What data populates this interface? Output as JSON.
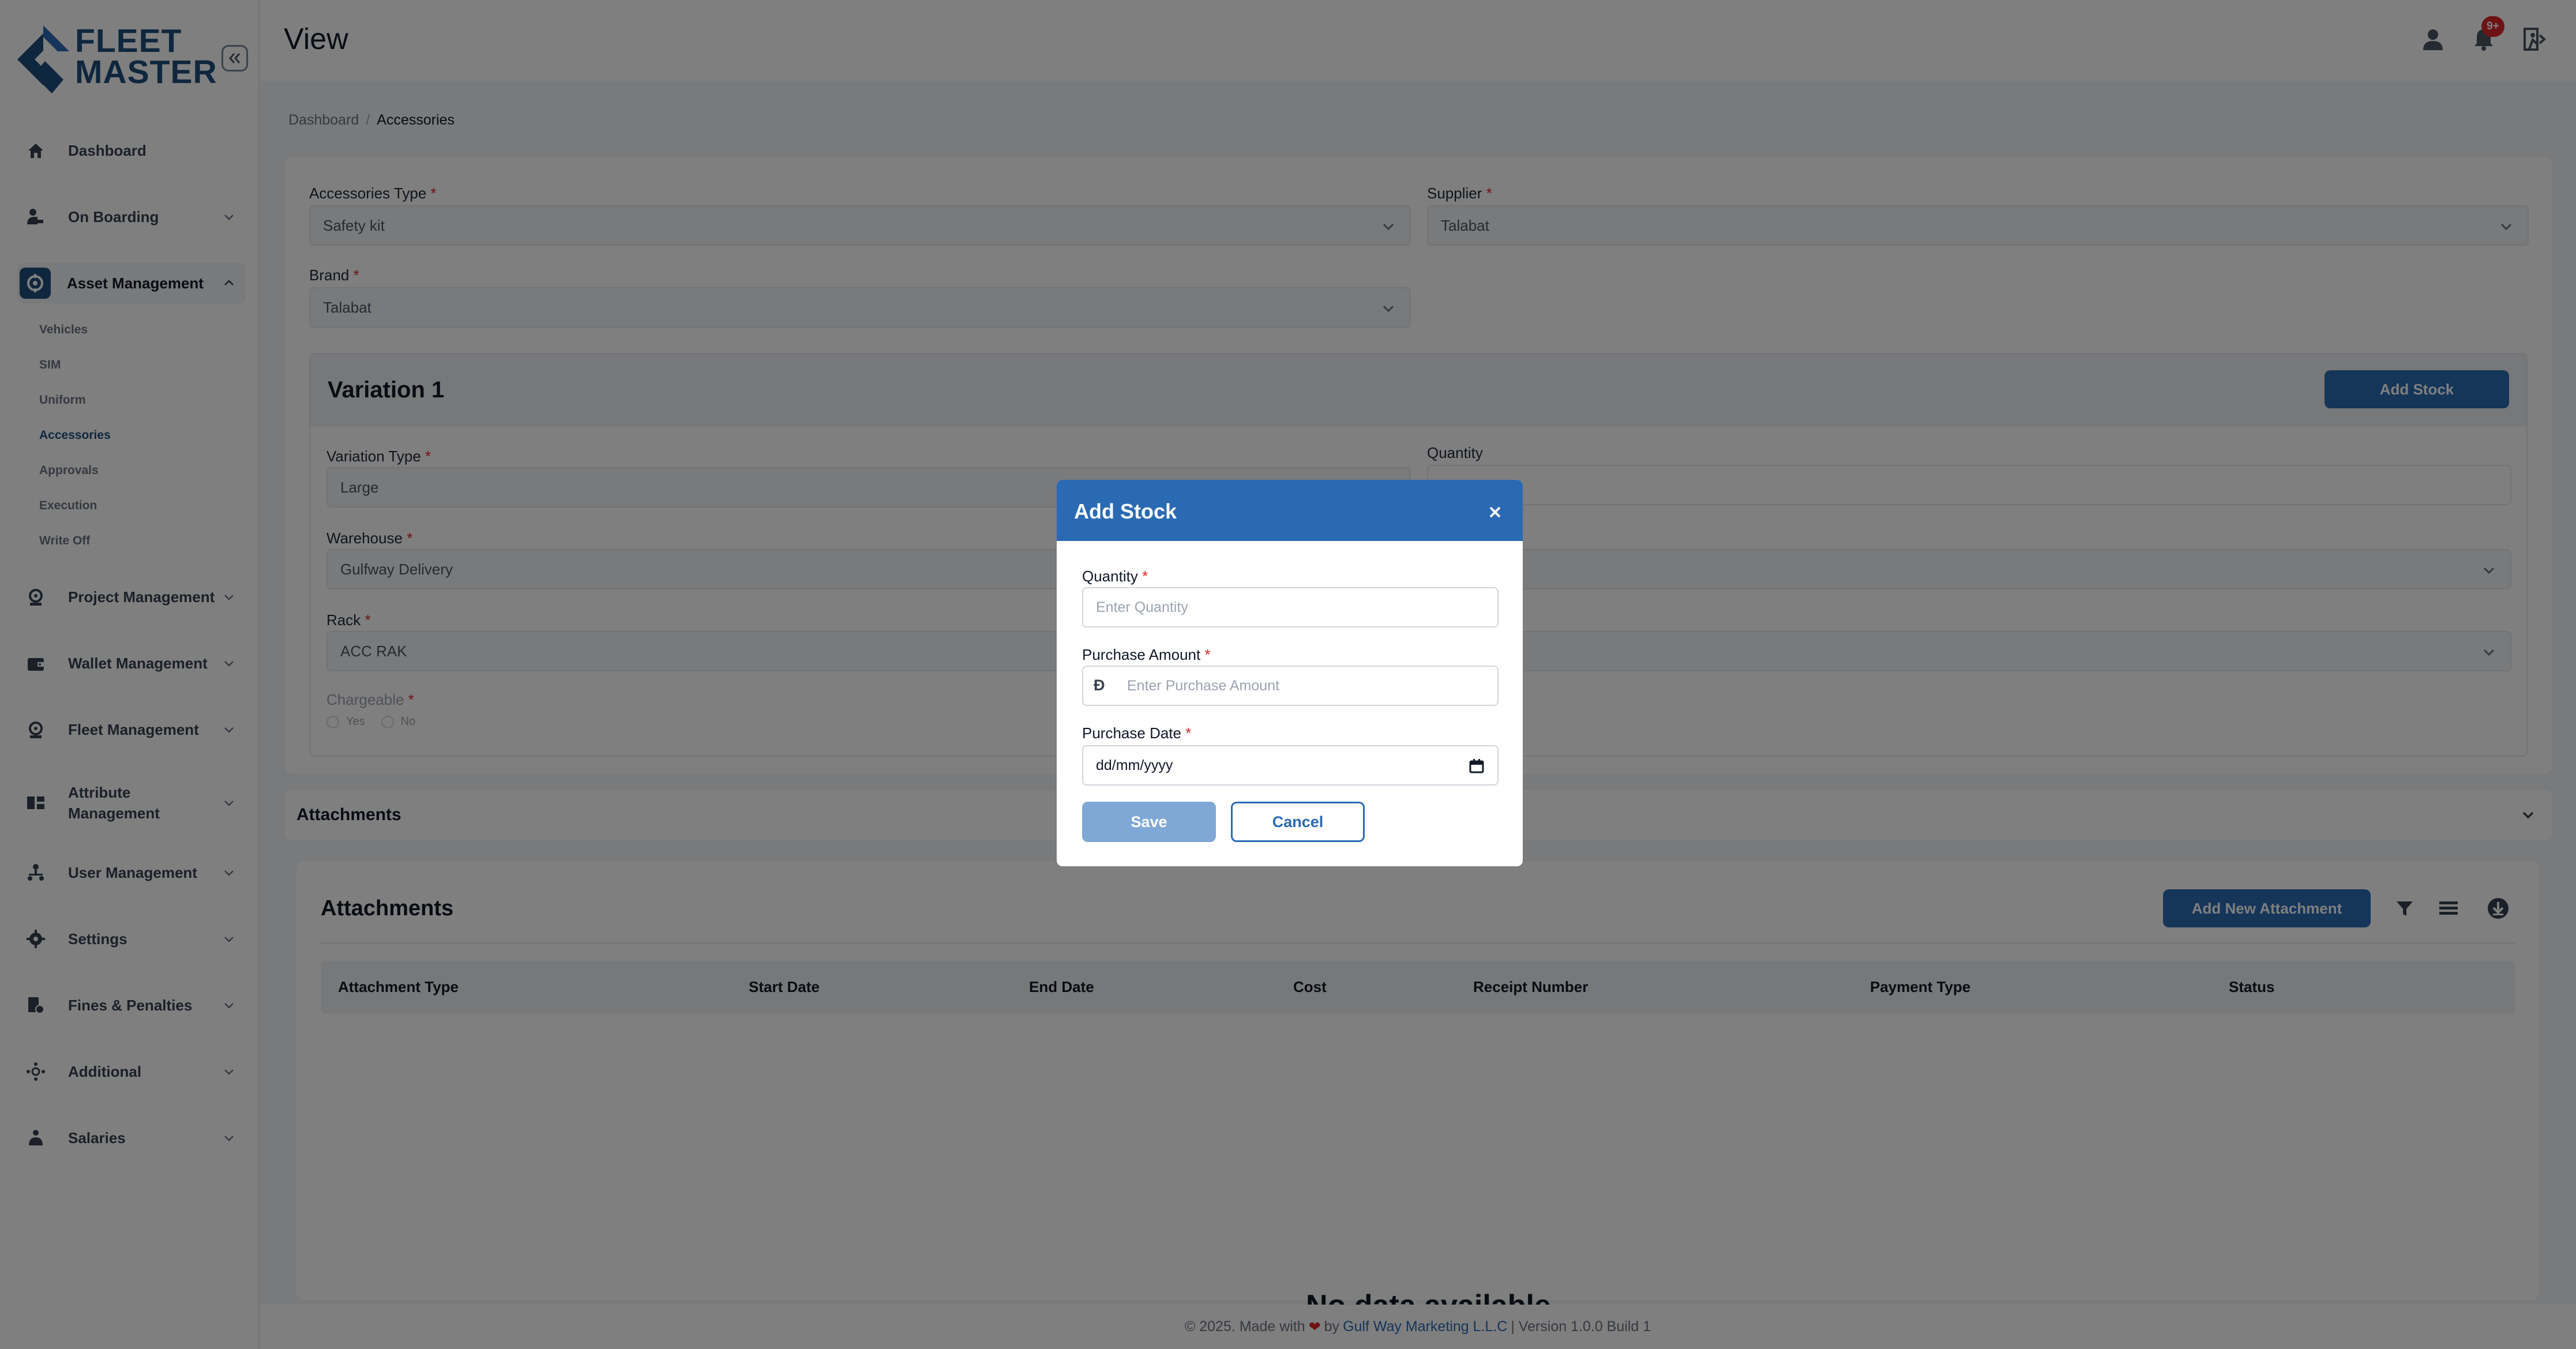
{
  "brand": {
    "line1": "FLEET",
    "line2": "MASTER"
  },
  "header": {
    "title": "View",
    "notification_count": "9+"
  },
  "sidebar": {
    "items": [
      {
        "label": "Dashboard",
        "icon": "home-icon"
      },
      {
        "label": "On Boarding",
        "icon": "onboarding-icon"
      },
      {
        "label": "Asset Management",
        "icon": "asset-icon"
      },
      {
        "label": "Project Management",
        "icon": "project-icon"
      },
      {
        "label": "Wallet Management",
        "icon": "wallet-icon"
      },
      {
        "label": "Fleet Management",
        "icon": "fleet-icon"
      },
      {
        "label": "Attribute Management",
        "icon": "attribute-icon"
      },
      {
        "label": "User Management",
        "icon": "users-icon"
      },
      {
        "label": "Settings",
        "icon": "gear-icon"
      },
      {
        "label": "Fines & Penalties",
        "icon": "fines-icon"
      },
      {
        "label": "Additional",
        "icon": "additional-icon"
      },
      {
        "label": "Salaries",
        "icon": "salaries-icon"
      }
    ],
    "asset_sub_items": [
      "Vehicles",
      "SIM",
      "Uniform",
      "Accessories",
      "Approvals",
      "Execution",
      "Write Off"
    ]
  },
  "breadcrumb": {
    "root": "Dashboard",
    "separator": "/",
    "current": "Accessories"
  },
  "form": {
    "accessories_type_label": "Accessories Type",
    "accessories_type_value": "Safety kit",
    "supplier_label": "Supplier",
    "supplier_value": "Talabat",
    "brand_label": "Brand",
    "brand_value": "Talabat",
    "required_mark": "*"
  },
  "variation": {
    "title": "Variation 1",
    "add_stock_label": "Add Stock",
    "variation_type_label": "Variation Type",
    "variation_type_value": "Large",
    "quantity_label": "Quantity",
    "warehouse_label": "Warehouse",
    "warehouse_value": "Gulfway Delivery",
    "rack_label": "Rack",
    "rack_value": "ACC RAK",
    "chargeable_label": "Chargeable",
    "chargeable_yes": "Yes",
    "chargeable_no": "No"
  },
  "attachments_section": {
    "title": "Attachments"
  },
  "attachments_card": {
    "title": "Attachments",
    "add_button": "Add New Attachment",
    "columns": [
      "Attachment Type",
      "Start Date",
      "End Date",
      "Cost",
      "Receipt Number",
      "Payment Type",
      "Status"
    ],
    "empty_text": "No data available"
  },
  "footer": {
    "prefix": "© 2025. Made with",
    "by": "by",
    "company": "Gulf Way Marketing L.L.C",
    "suffix": "| Version 1.0.0 Build 1"
  },
  "modal": {
    "title": "Add Stock",
    "quantity_label": "Quantity",
    "quantity_placeholder": "Enter Quantity",
    "amount_label": "Purchase Amount",
    "amount_placeholder": "Enter Purchase Amount",
    "currency_symbol": "Ð",
    "date_label": "Purchase Date",
    "date_placeholder": "dd/mm/yyyy",
    "save_label": "Save",
    "cancel_label": "Cancel",
    "required_mark": "*"
  },
  "colors": {
    "primary": "#2a6ab3",
    "brand_dark": "#1e4f7d",
    "danger": "#dc2626",
    "overlay": "rgba(0,0,0,0.5)"
  }
}
